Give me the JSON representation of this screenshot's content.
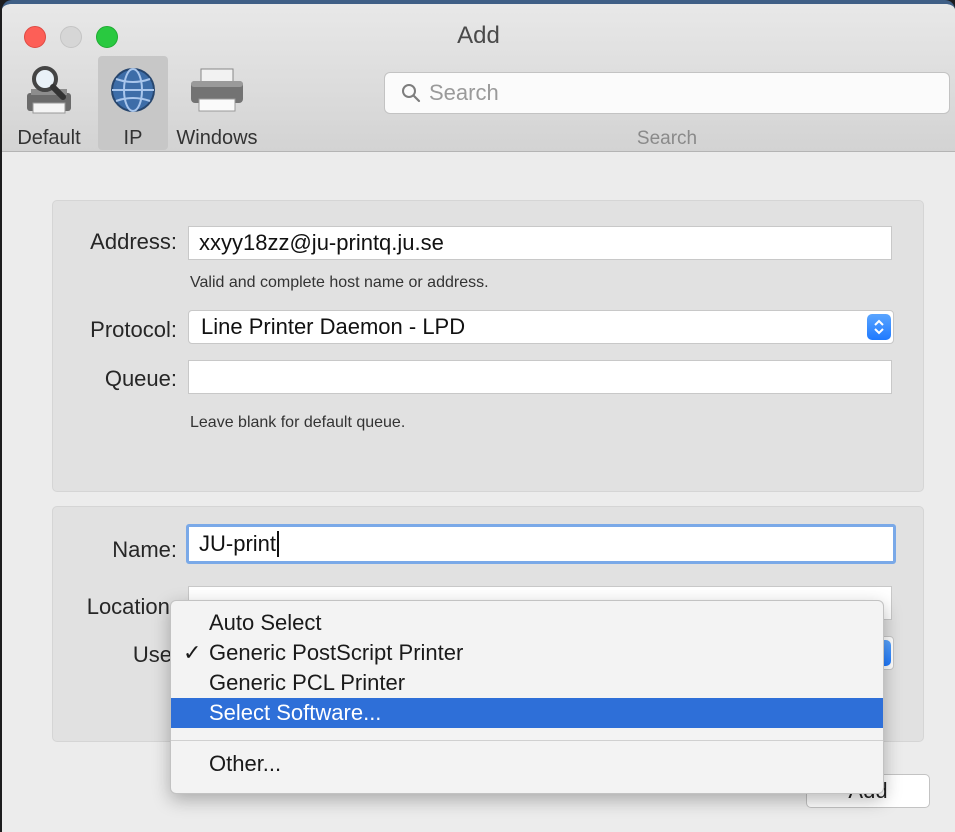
{
  "window": {
    "title": "Add"
  },
  "toolbar": {
    "items": [
      {
        "label": "Default",
        "icon": "magnifier-printer-icon"
      },
      {
        "label": "IP",
        "icon": "globe-icon"
      },
      {
        "label": "Windows",
        "icon": "printer-icon"
      }
    ],
    "selected": "IP",
    "search": {
      "placeholder": "Search",
      "label": "Search"
    }
  },
  "form": {
    "address": {
      "label": "Address:",
      "value": "xxyy18zz@ju-printq.ju.se",
      "hint": "Valid and complete host name or address."
    },
    "protocol": {
      "label": "Protocol:",
      "value": "Line Printer Daemon - LPD"
    },
    "queue": {
      "label": "Queue:",
      "value": "",
      "hint": "Leave blank for default queue."
    },
    "name": {
      "label": "Name:",
      "value": "JU-print"
    },
    "location": {
      "label": "Location:",
      "value": ""
    },
    "use": {
      "label": "Use"
    }
  },
  "use_menu": {
    "items": [
      {
        "label": "Auto Select",
        "checked": false,
        "highlighted": false
      },
      {
        "label": "Generic PostScript Printer",
        "checked": true,
        "highlighted": false
      },
      {
        "label": "Generic PCL Printer",
        "checked": false,
        "highlighted": false
      },
      {
        "label": "Select Software...",
        "checked": false,
        "highlighted": true
      }
    ],
    "other": "Other...",
    "check_mark": "✓"
  },
  "buttons": {
    "add": "Add"
  },
  "colors": {
    "highlight": "#2e6fd8",
    "focus_ring": "#7aa9e8",
    "close": "#fd5f57",
    "zoom": "#29c940"
  }
}
